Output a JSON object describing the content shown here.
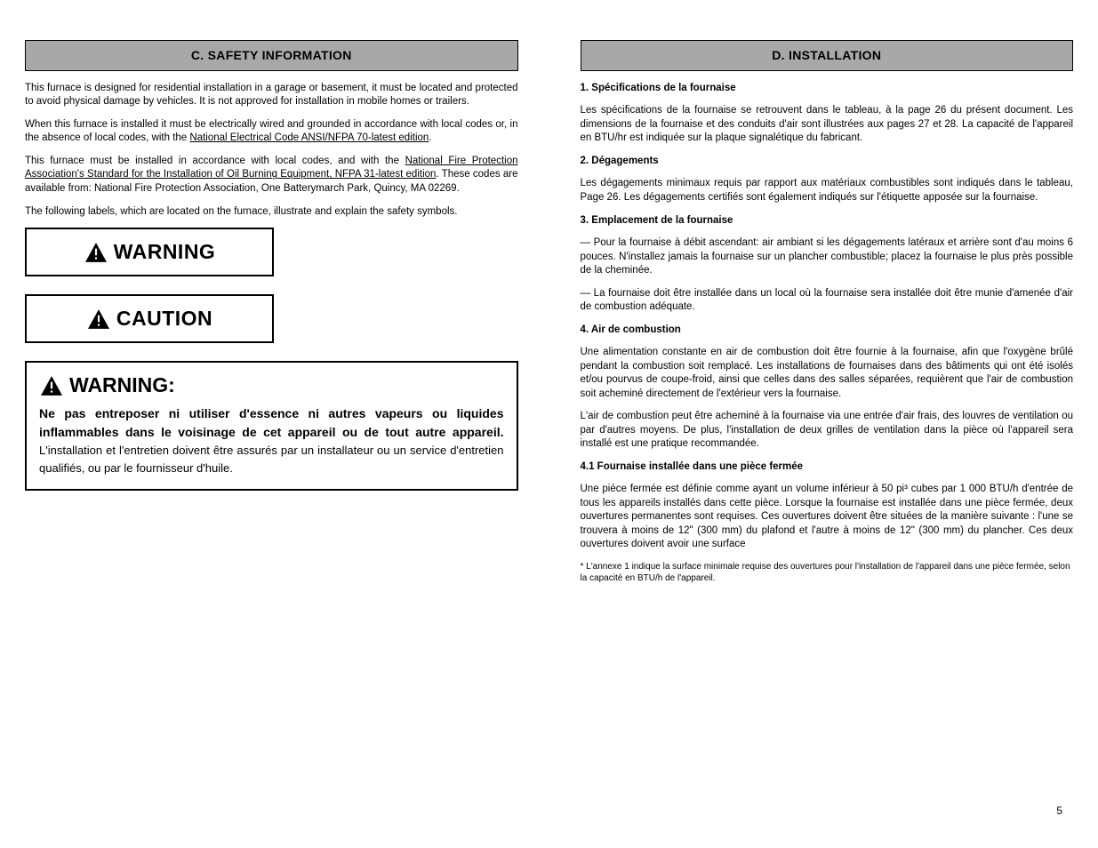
{
  "left": {
    "header": "C. SAFETY INFORMATION",
    "p1": "This furnace is designed for residential installation in a garage or basement, it must be located and protected to avoid physical damage by vehicles. It is not approved for installation in mobile homes or trailers.",
    "p2_prefix": "When this furnace is installed it must be electrically wired and grounded in accordance with local codes or, in the absence of local codes, with the ",
    "p2_link": "National Electrical Code ANSI/NFPA 70-latest edition",
    "p2_suffix": ".",
    "p3_prefix": "This furnace must be installed in accordance with local codes, and with the ",
    "p3_link": "National Fire Protection Association's Standard for the Installation of Oil Burning Equipment, NFPA 31-latest edition",
    "p3_suffix": ". These codes are available from: National Fire Protection Association, One Batterymarch Park, Quincy, MA 02269.",
    "p4": "The following labels, which are located on the furnace, illustrate and explain the safety symbols.",
    "warning_label": "WARNING",
    "caution_label": "CAUTION",
    "warn_box_sig": "WARNING:",
    "warn_box_body_big": "Ne pas entreposer ni utiliser d'essence ni autres vapeurs ou liquides inflammables dans le voisinage de cet appareil ou de tout autre appareil.",
    "warn_box_body_rest": " L'installation et l'entretien doivent être assurés par un installateur ou un service d'entretien qualifiés, ou par le fournisseur d'huile."
  },
  "right": {
    "header": "D. INSTALLATION",
    "section1_title": "1. Spécifications de la fournaise",
    "section1_body": "Les spécifications de la fournaise se retrouvent dans le tableau, à la page 26 du présent document. Les dimensions de la fournaise et des conduits d'air sont illustrées aux pages 27 et 28. La capacité de l'appareil en BTU/hr est indiquée sur la plaque signalétique du fabricant.",
    "section2_title": "2. Dégagements",
    "section2_body": "Les dégagements minimaux requis par rapport aux matériaux combustibles sont indiqués dans le tableau, Page 26. Les dégagements certifiés sont également indiqués sur l'étiquette apposée sur la fournaise.",
    "section3_title": "3. Emplacement de la fournaise",
    "section3_line1": "— Pour la fournaise à débit ascendant: air ambiant si les dégagements latéraux et arrière sont d'au moins 6 pouces. N'installez jamais la fournaise sur un plancher combustible; placez la fournaise le plus près possible de la cheminée.",
    "section3_line2": "— La fournaise doit être installée dans un local où la fournaise sera installée doit être munie d'amenée d'air de combustion adéquate.",
    "section4_title": "4. Air de combustion",
    "section4_body1": "Une alimentation constante en air de combustion doit être fournie à la fournaise, afin que l'oxygène brûlé pendant la combustion soit remplacé. Les installations de fournaises dans des bâtiments qui ont été isolés et/ou pourvus de coupe-froid, ainsi que celles dans des salles séparées, requièrent que l'air de combustion soit acheminé directement de l'extérieur vers la fournaise.",
    "section4_body2": "L'air de combustion peut être acheminé à la fournaise via une entrée d'air frais, des louvres de ventilation ou par d'autres moyens. De plus, l'installation de deux grilles de ventilation dans la pièce où l'appareil sera installé est une pratique recommandée.",
    "section4_ref": "4.1 Fournaise installée dans une pièce fermée",
    "section4_note": "Une pièce fermée est définie comme ayant un volume inférieur à 50 pi³ cubes par 1 000 BTU/h d'entrée de tous les appareils installés dans cette pièce. Lorsque la fournaise est installée dans une pièce fermée, deux ouvertures permanentes sont requises. Ces ouvertures doivent être situées de la manière suivante : l'une se trouvera à moins de 12\" (300 mm) du plafond et l'autre à moins de 12\" (300 mm) du plancher. Ces deux ouvertures doivent avoir une surface",
    "footnote": "* L'annexe 1 indique la surface minimale requise des ouvertures pour l'installation de l'appareil dans une pièce fermée, selon la capacité en BTU/h de l'appareil."
  },
  "page_number": "5"
}
